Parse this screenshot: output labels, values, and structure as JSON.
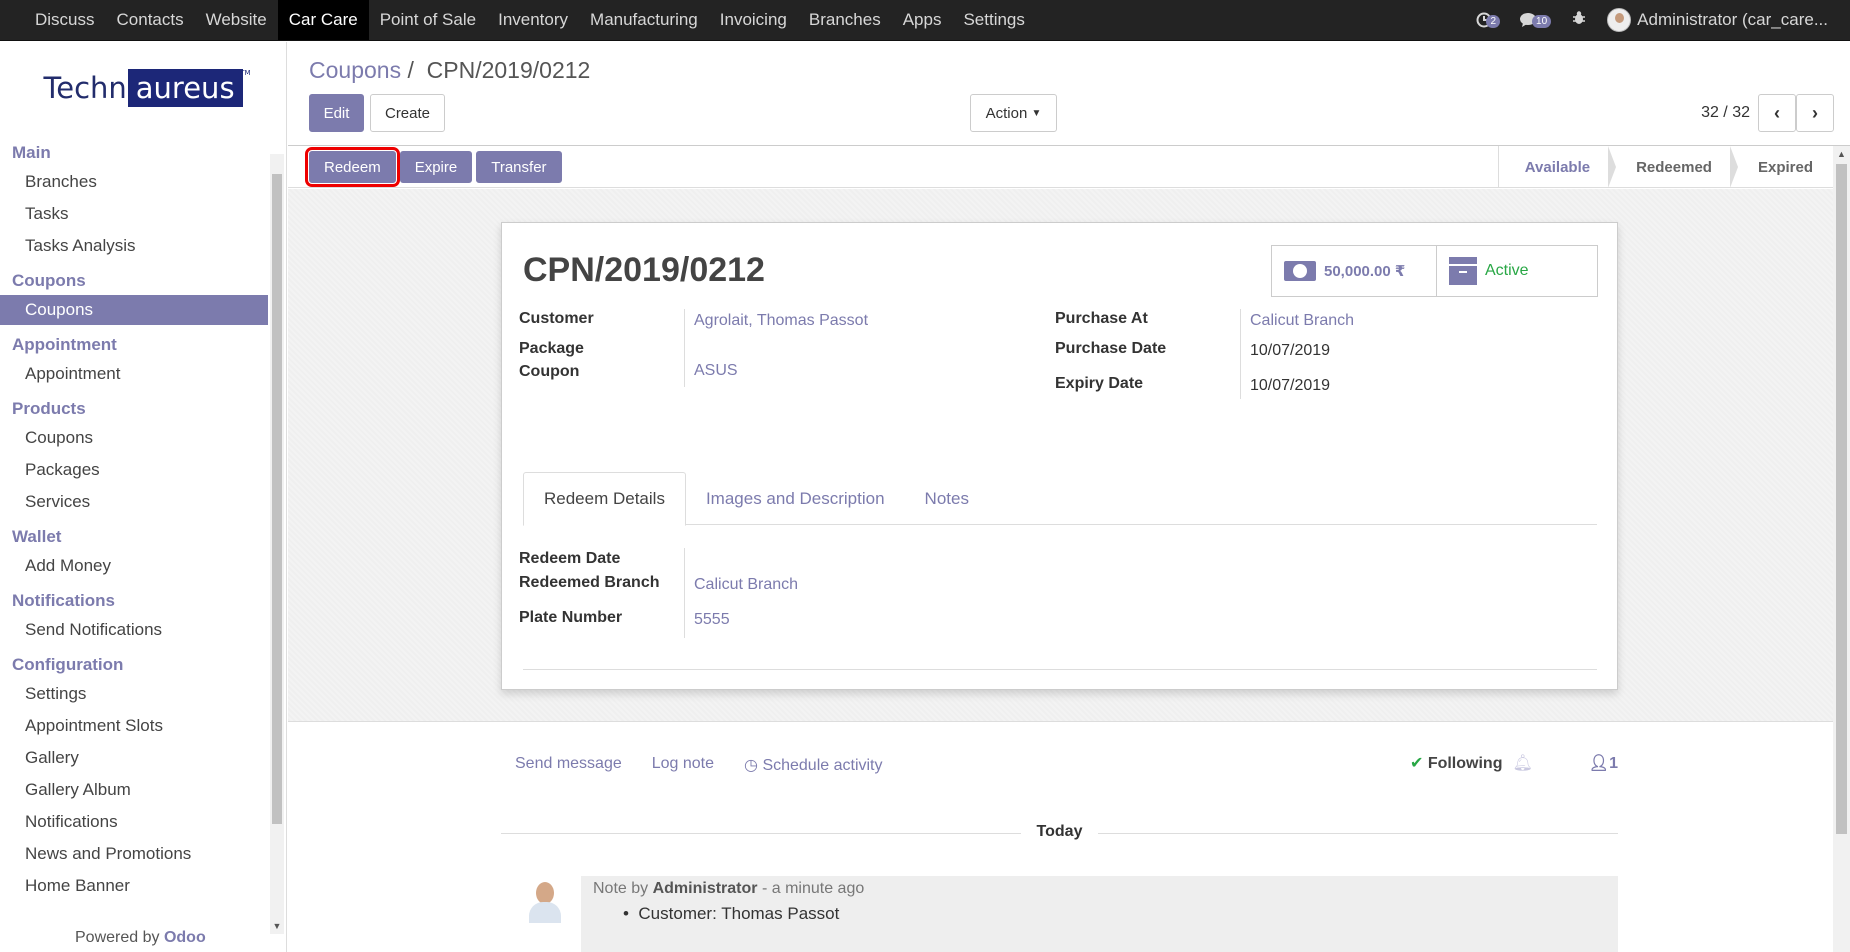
{
  "topbar": {
    "menu": [
      "Discuss",
      "Contacts",
      "Website",
      "Car Care",
      "Point of Sale",
      "Inventory",
      "Manufacturing",
      "Invoicing",
      "Branches",
      "Apps",
      "Settings"
    ],
    "activity_count": "2",
    "message_count": "10",
    "user": "Administrator (car_care..."
  },
  "sidebar": {
    "logo_left": "Techn",
    "logo_box": "aureus",
    "sections": [
      {
        "title": "Main",
        "items": [
          "Branches",
          "Tasks",
          "Tasks Analysis"
        ]
      },
      {
        "title": "Coupons",
        "items": [
          "Coupons"
        ]
      },
      {
        "title": "Appointment",
        "items": [
          "Appointment"
        ]
      },
      {
        "title": "Products",
        "items": [
          "Coupons",
          "Packages",
          "Services"
        ]
      },
      {
        "title": "Wallet",
        "items": [
          "Add Money"
        ]
      },
      {
        "title": "Notifications",
        "items": [
          "Send Notifications"
        ]
      },
      {
        "title": "Configuration",
        "items": [
          "Settings",
          "Appointment Slots",
          "Gallery",
          "Gallery Album",
          "Notifications",
          "News and Promotions",
          "Home Banner"
        ]
      }
    ],
    "powered_prefix": "Powered by",
    "powered_brand": "Odoo"
  },
  "control": {
    "crumb_parent": "Coupons",
    "crumb_sep": "/",
    "crumb_current": "CPN/2019/0212",
    "edit": "Edit",
    "create": "Create",
    "action": "Action",
    "pager": "32 / 32"
  },
  "statusbar": {
    "redeem": "Redeem",
    "expire": "Expire",
    "transfer": "Transfer",
    "stages": [
      "Available",
      "Redeemed",
      "Expired"
    ]
  },
  "form": {
    "title": "CPN/2019/0212",
    "amount": "50,000.00 ₹",
    "state": "Active",
    "customer_label": "Customer",
    "customer": "Agrolait, Thomas Passot",
    "package_label": "Package",
    "coupon_label": "Coupon",
    "package_coupon": "ASUS",
    "purchase_at_label": "Purchase At",
    "purchase_at": "Calicut Branch",
    "purchase_date_label": "Purchase Date",
    "purchase_date": "10/07/2019",
    "expiry_date_label": "Expiry Date",
    "expiry_date": "10/07/2019",
    "tabs": [
      "Redeem Details",
      "Images and Description",
      "Notes"
    ],
    "redeem_date_label": "Redeem Date",
    "redeemed_branch_label": "Redeemed Branch",
    "redeemed_branch": "Calicut Branch",
    "plate_label": "Plate Number",
    "plate": "5555"
  },
  "chatter": {
    "send_message": "Send message",
    "log_note": "Log note",
    "schedule": "Schedule activity",
    "following": "Following",
    "followers": "1",
    "today": "Today",
    "note_prefix": "Note by",
    "note_author": "Administrator",
    "note_time": "- a minute ago",
    "note_line": "Customer: Thomas Passot"
  }
}
